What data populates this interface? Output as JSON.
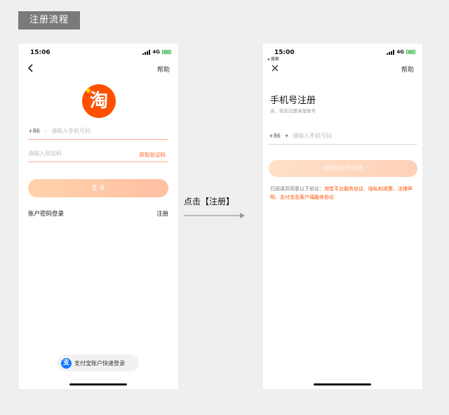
{
  "heading": "注册流程",
  "left_phone": {
    "time": "15:06",
    "network": "4G",
    "help": "帮助",
    "logo_text": "淘",
    "phone_prefix": "+86",
    "phone_placeholder": "请输入手机号码",
    "code_placeholder": "请输入验证码",
    "get_code": "获取验证码",
    "login_button": "登 录",
    "password_login": "账户密码登录",
    "register": "注册",
    "alipay_login": "支付宝账户快速登录",
    "alipay_icon_text": "支"
  },
  "arrow_label": "点击【注册】",
  "right_phone": {
    "time": "15:00",
    "back_app": "◂ 搜索",
    "network": "4G",
    "help": "帮助",
    "title": "手机号注册",
    "subtitle": "亲，欢迎注册淘宝账号",
    "phone_prefix": "+86",
    "phone_placeholder": "请输入手机号码",
    "agree_button": "同意协议并注册",
    "agreement_intro": "已阅读并同意以下协议：",
    "agreement_links": "淘宝平台服务协议、隐私权政策、法律声明、支付宝及客户端服务协议"
  },
  "colors": {
    "brand": "#ff5000",
    "alipay": "#1677ff",
    "button": "#ffc9a8"
  }
}
